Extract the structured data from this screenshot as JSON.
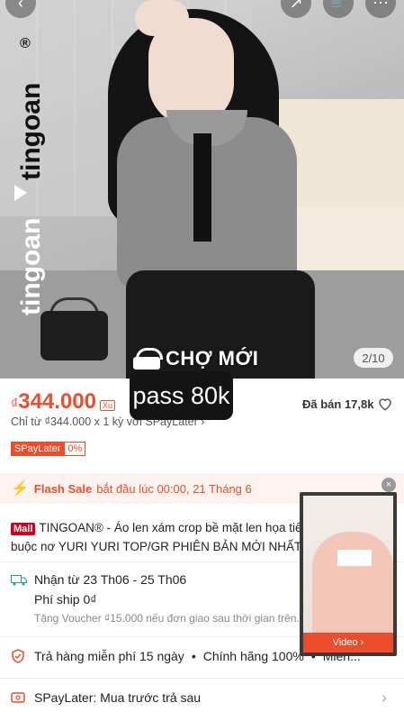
{
  "hero": {
    "brand_text": "tingoan",
    "brand_reg": "®",
    "image_counter": "2/10",
    "watermark": "CHỢ MỚI",
    "pass_text": "pass 80k"
  },
  "nav": {
    "back": "‹",
    "share": "↗",
    "cart": "🛒",
    "more": "⋯"
  },
  "price": {
    "currency": "₫",
    "value": "344.000",
    "badge": "Xu",
    "sold": "Đã bán 17,8k",
    "installment": "Chỉ từ ₫344.000 x 1 kỳ với SPayLater ›",
    "spaylater_tag": "SPayLater",
    "spaylater_pct": "0%"
  },
  "flash": {
    "label": "Flash Sale",
    "text": "bắt đầu lúc 00:00, 21 Tháng 6",
    "chevron": "›"
  },
  "title": {
    "mall_tag": "Mall",
    "text": "TINGOAN® - Áo len xám crop bề mặt len họa tiết buộc nơ YURI YURI TOP/GR PHIÊN BẢN MỚI NHẤT"
  },
  "shipping": {
    "line1": "Nhận từ 23 Th06 - 25 Th06",
    "line2": "Phí ship 0₫",
    "line3": "Tặng Voucher ₫15.000 nếu đơn giao sau thời gian trên."
  },
  "returns": {
    "item1": "Trả hàng miễn phí 15 ngày",
    "item2": "Chính hãng 100%",
    "item3": "Miễn..."
  },
  "spaylater_row": {
    "text": "SPayLater: Mua trước trả sau",
    "chevron": "›"
  },
  "video_float": {
    "button": "Video ›",
    "close": "×"
  },
  "colors": {
    "accent": "#ee4d2d",
    "mall": "#d0011b"
  }
}
